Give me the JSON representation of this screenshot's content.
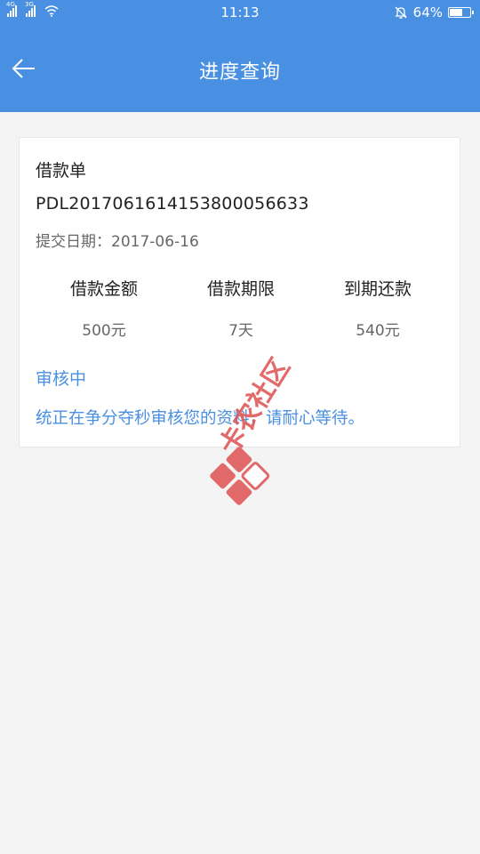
{
  "status_bar": {
    "net1": "4G",
    "net2": "3G",
    "time": "11:13",
    "battery": "64%",
    "battery_level": 0.64
  },
  "header": {
    "title": "进度查询",
    "back_icon": "arrow-left-icon"
  },
  "card": {
    "title": "借款单",
    "order_no": "PDL20170616141538000566​33",
    "submit_date": "提交日期：2017-06-16",
    "columns": [
      {
        "label": "借款金额",
        "value": "500元"
      },
      {
        "label": "借款期限",
        "value": "7天"
      },
      {
        "label": "到期还款",
        "value": "540元"
      }
    ],
    "status": "审核中",
    "status_message": "统正在争分夺秒审核您的资料，请耐心等待。"
  },
  "watermark": {
    "text": "卡农社区"
  },
  "colors": {
    "accent": "#4a90e2",
    "background": "#f4f4f4"
  }
}
